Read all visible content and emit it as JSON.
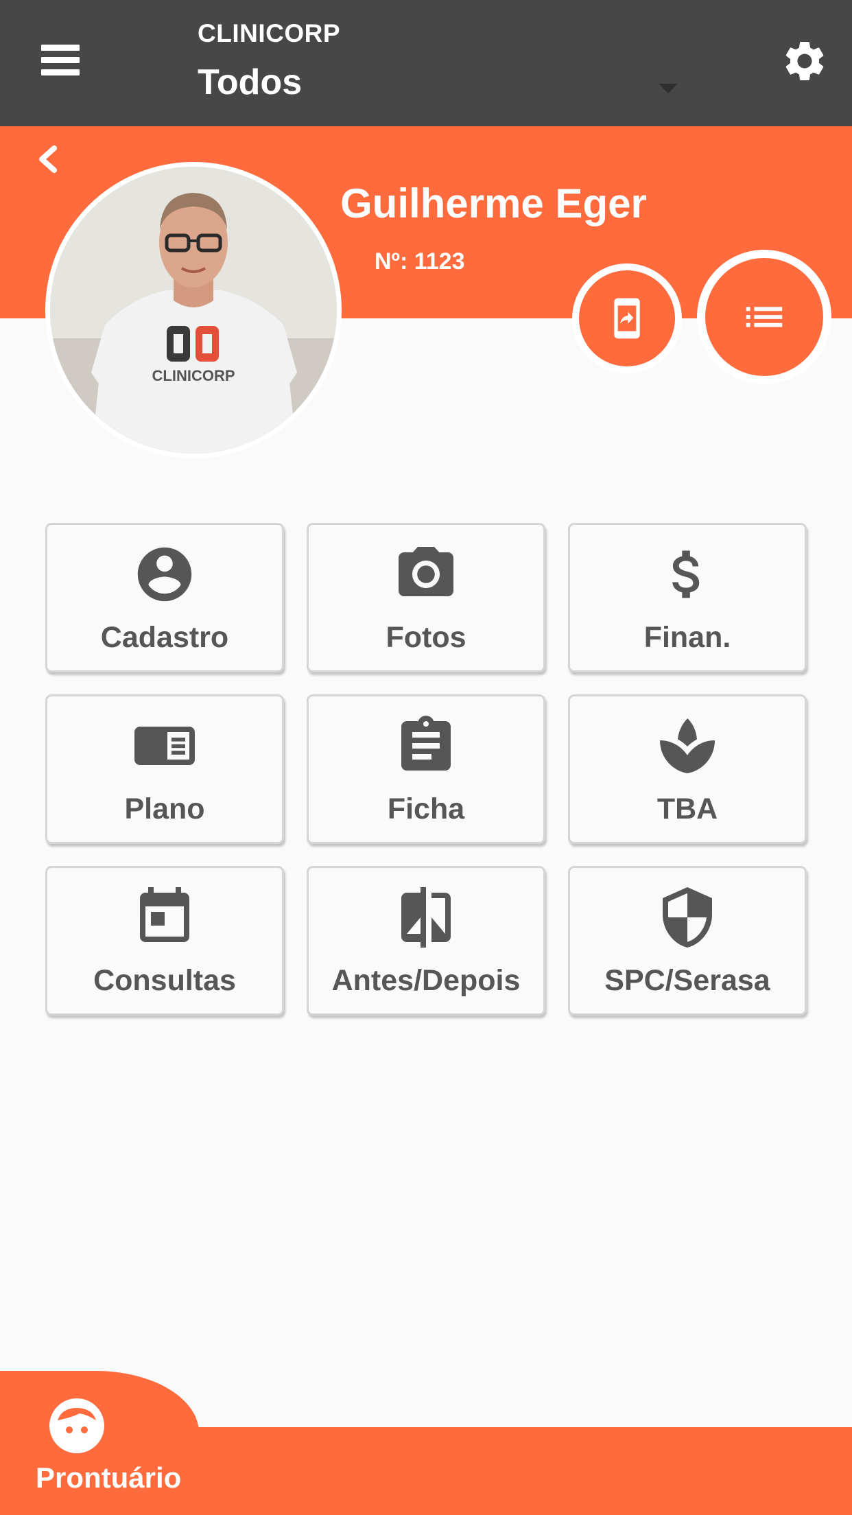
{
  "app_bar": {
    "org_name": "CLINICORP",
    "selected_filter": "Todos",
    "menu_icon": "hamburger-menu-icon",
    "settings_icon": "gear-icon"
  },
  "patient": {
    "name": "Guilherme Eger",
    "number": "Nº: 1123",
    "shirt_logo_text": "CLINICORP"
  },
  "actions": {
    "share_icon": "mobile-share-icon",
    "list_icon": "list-icon"
  },
  "tiles": [
    {
      "label": "Cadastro",
      "icon": "account-circle-icon"
    },
    {
      "label": "Fotos",
      "icon": "camera-icon"
    },
    {
      "label": "Finan.",
      "icon": "dollar-icon"
    },
    {
      "label": "Plano",
      "icon": "book-plan-icon"
    },
    {
      "label": "Ficha",
      "icon": "clipboard-icon"
    },
    {
      "label": "TBA",
      "icon": "spa-leaf-icon"
    },
    {
      "label": "Consultas",
      "icon": "calendar-icon"
    },
    {
      "label": "Antes/Depois",
      "icon": "compare-icon"
    },
    {
      "label": "SPC/Serasa",
      "icon": "shield-icon"
    }
  ],
  "bottom_nav": {
    "label": "Prontuário",
    "icon": "face-icon"
  },
  "colors": {
    "accent": "#ff6b3d",
    "app_bar": "#474747",
    "tile_text": "#565656",
    "background": "#fafafa"
  }
}
